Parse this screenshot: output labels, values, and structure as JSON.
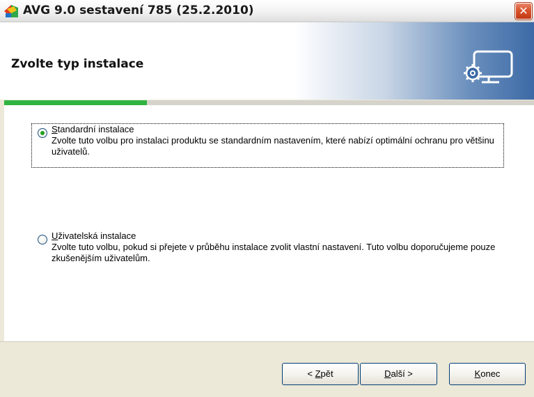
{
  "window": {
    "title": "AVG 9.0 sestavení 785 (25.2.2010)",
    "close_label": "✕"
  },
  "header": {
    "title": "Zvolte typ instalace",
    "icon": "monitor-gear-icon"
  },
  "progress": {
    "fraction": 0.27,
    "color": "#2fb341"
  },
  "options": [
    {
      "label_accel": "S",
      "label_rest": "tandardní instalace",
      "description": "Zvolte tuto volbu pro instalaci produktu se standardním nastavením, které nabízí optimální ochranu pro většinu uživatelů.",
      "selected": true
    },
    {
      "label_accel": "U",
      "label_rest": "živatelská instalace",
      "description": "Zvolte tuto volbu, pokud si přejete v průběhu instalace zvolit vlastní nastavení. Tuto volbu doporučujeme pouze zkušenějším uživatelům.",
      "selected": false
    }
  ],
  "buttons": {
    "back_prefix": "< ",
    "back_accel": "Z",
    "back_rest": "pět",
    "next_accel": "D",
    "next_rest": "alší >",
    "cancel_accel": "K",
    "cancel_rest": "onec"
  },
  "colors": {
    "accent_green": "#2fb341",
    "header_blue": "#3d6aa6"
  }
}
